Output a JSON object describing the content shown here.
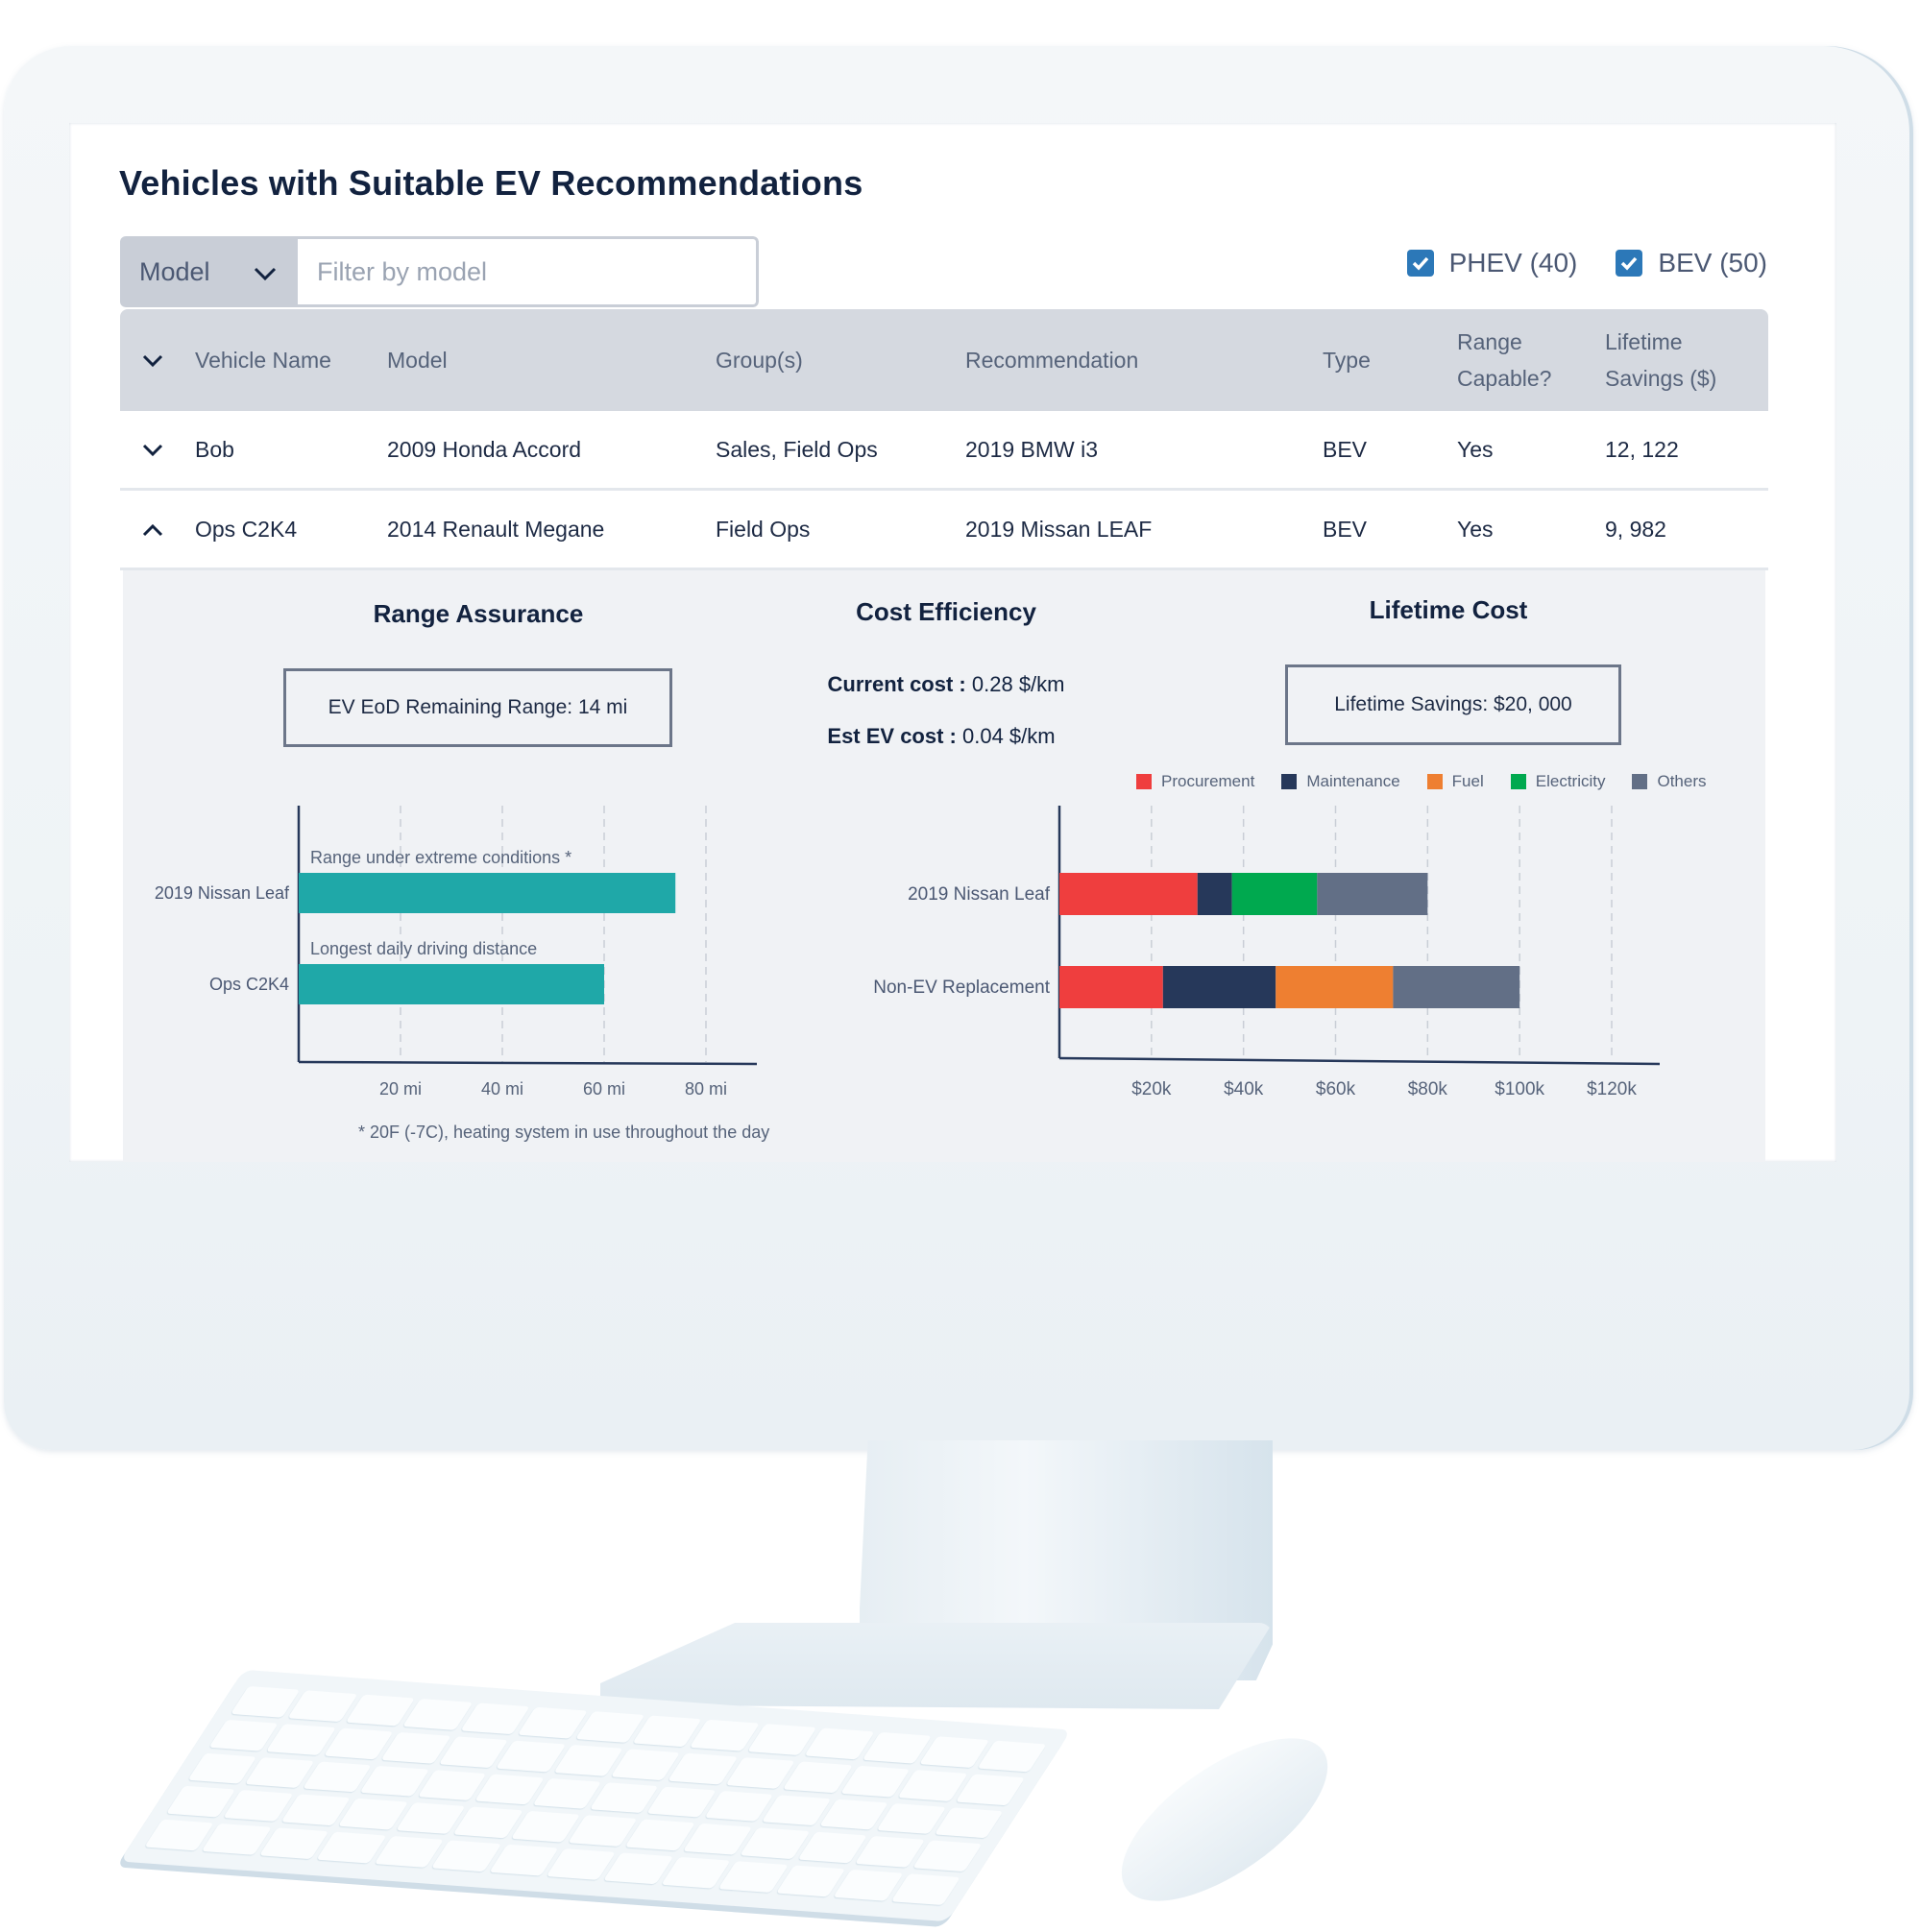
{
  "page": {
    "title": "Vehicles with Suitable EV Recommendations"
  },
  "filter": {
    "select_label": "Model",
    "input_placeholder": "Filter by model",
    "input_value": ""
  },
  "type_filters": [
    {
      "label": "PHEV (40)",
      "checked": true
    },
    {
      "label": "BEV (50)",
      "checked": true
    }
  ],
  "colors": {
    "accent": "#2c78b8",
    "title": "#12223f",
    "header_bg": "#d5d9e0",
    "panel_bg": "#f0f2f5",
    "range_bar": "#1fa8a8"
  },
  "table": {
    "headers": [
      "Vehicle Name",
      "Model",
      "Group(s)",
      "Recommendation",
      "Type",
      "Range Capable?",
      "Lifetime Savings ($)"
    ],
    "header_lines": {
      "range_capable": [
        "Range",
        "Capable?"
      ],
      "lifetime_savings": [
        "Lifetime",
        "Savings ($)"
      ]
    },
    "rows": [
      {
        "expanded": false,
        "vehicle_name": "Bob",
        "model": "2009 Honda Accord",
        "groups": "Sales, Field Ops",
        "recommendation": "2019 BMW i3",
        "type": "BEV",
        "range_capable": "Yes",
        "lifetime_savings": "12, 122"
      },
      {
        "expanded": true,
        "vehicle_name": "Ops C2K4",
        "model": "2014 Renault Megane",
        "groups": "Field Ops",
        "recommendation": "2019 Missan LEAF",
        "type": "BEV",
        "range_capable": "Yes",
        "lifetime_savings": "9, 982"
      }
    ]
  },
  "details": {
    "range_assurance": {
      "title": "Range Assurance",
      "summary": "EV EoD Remaining Range: 14 mi",
      "footnote": "* 20F (-7C), heating system in use throughout the day"
    },
    "cost_efficiency": {
      "title": "Cost Efficiency",
      "current_label": "Current cost :",
      "current_value": "0.28 $/km",
      "ev_label": "Est EV cost :",
      "ev_value": "0.04 $/km"
    },
    "lifetime_cost": {
      "title": "Lifetime Cost",
      "summary": "Lifetime Savings: $20, 000"
    }
  },
  "chart_data": [
    {
      "type": "bar",
      "orientation": "horizontal",
      "title": "Range Assurance",
      "categories": [
        "2019 Nissan Leaf",
        "Ops C2K4"
      ],
      "values": [
        74,
        60
      ],
      "bar_labels": [
        "Range under extreme conditions *",
        "Longest daily driving distance"
      ],
      "xlabel": "",
      "ylabel": "",
      "xlim": [
        0,
        90
      ],
      "xticks": [
        20,
        40,
        60,
        80
      ],
      "xtick_labels": [
        "20 mi",
        "40 mi",
        "60 mi",
        "80 mi"
      ],
      "grid": "vertical dashed",
      "color": "#1fa8a8"
    },
    {
      "type": "bar",
      "orientation": "horizontal",
      "stacked": true,
      "title": "Lifetime Cost",
      "categories": [
        "2019 Nissan Leaf",
        "Non-EV Replacement"
      ],
      "series": [
        {
          "name": "Procurement",
          "color": "#ef3e3e",
          "values": [
            30000,
            22500
          ]
        },
        {
          "name": "Maintenance",
          "color": "#26385a",
          "values": [
            7500,
            24500
          ]
        },
        {
          "name": "Fuel",
          "color": "#ee7f31",
          "values": [
            0,
            25500
          ]
        },
        {
          "name": "Electricity",
          "color": "#00a94f",
          "values": [
            18500,
            0
          ]
        },
        {
          "name": "Others",
          "color": "#626f86",
          "values": [
            24000,
            27500
          ]
        }
      ],
      "xlim": [
        0,
        130000
      ],
      "xticks": [
        20000,
        40000,
        60000,
        80000,
        100000,
        120000
      ],
      "xtick_labels": [
        "$20k",
        "$40k",
        "$60k",
        "$80k",
        "$100k",
        "$120k"
      ],
      "legend": "top",
      "grid": "vertical dashed"
    }
  ]
}
